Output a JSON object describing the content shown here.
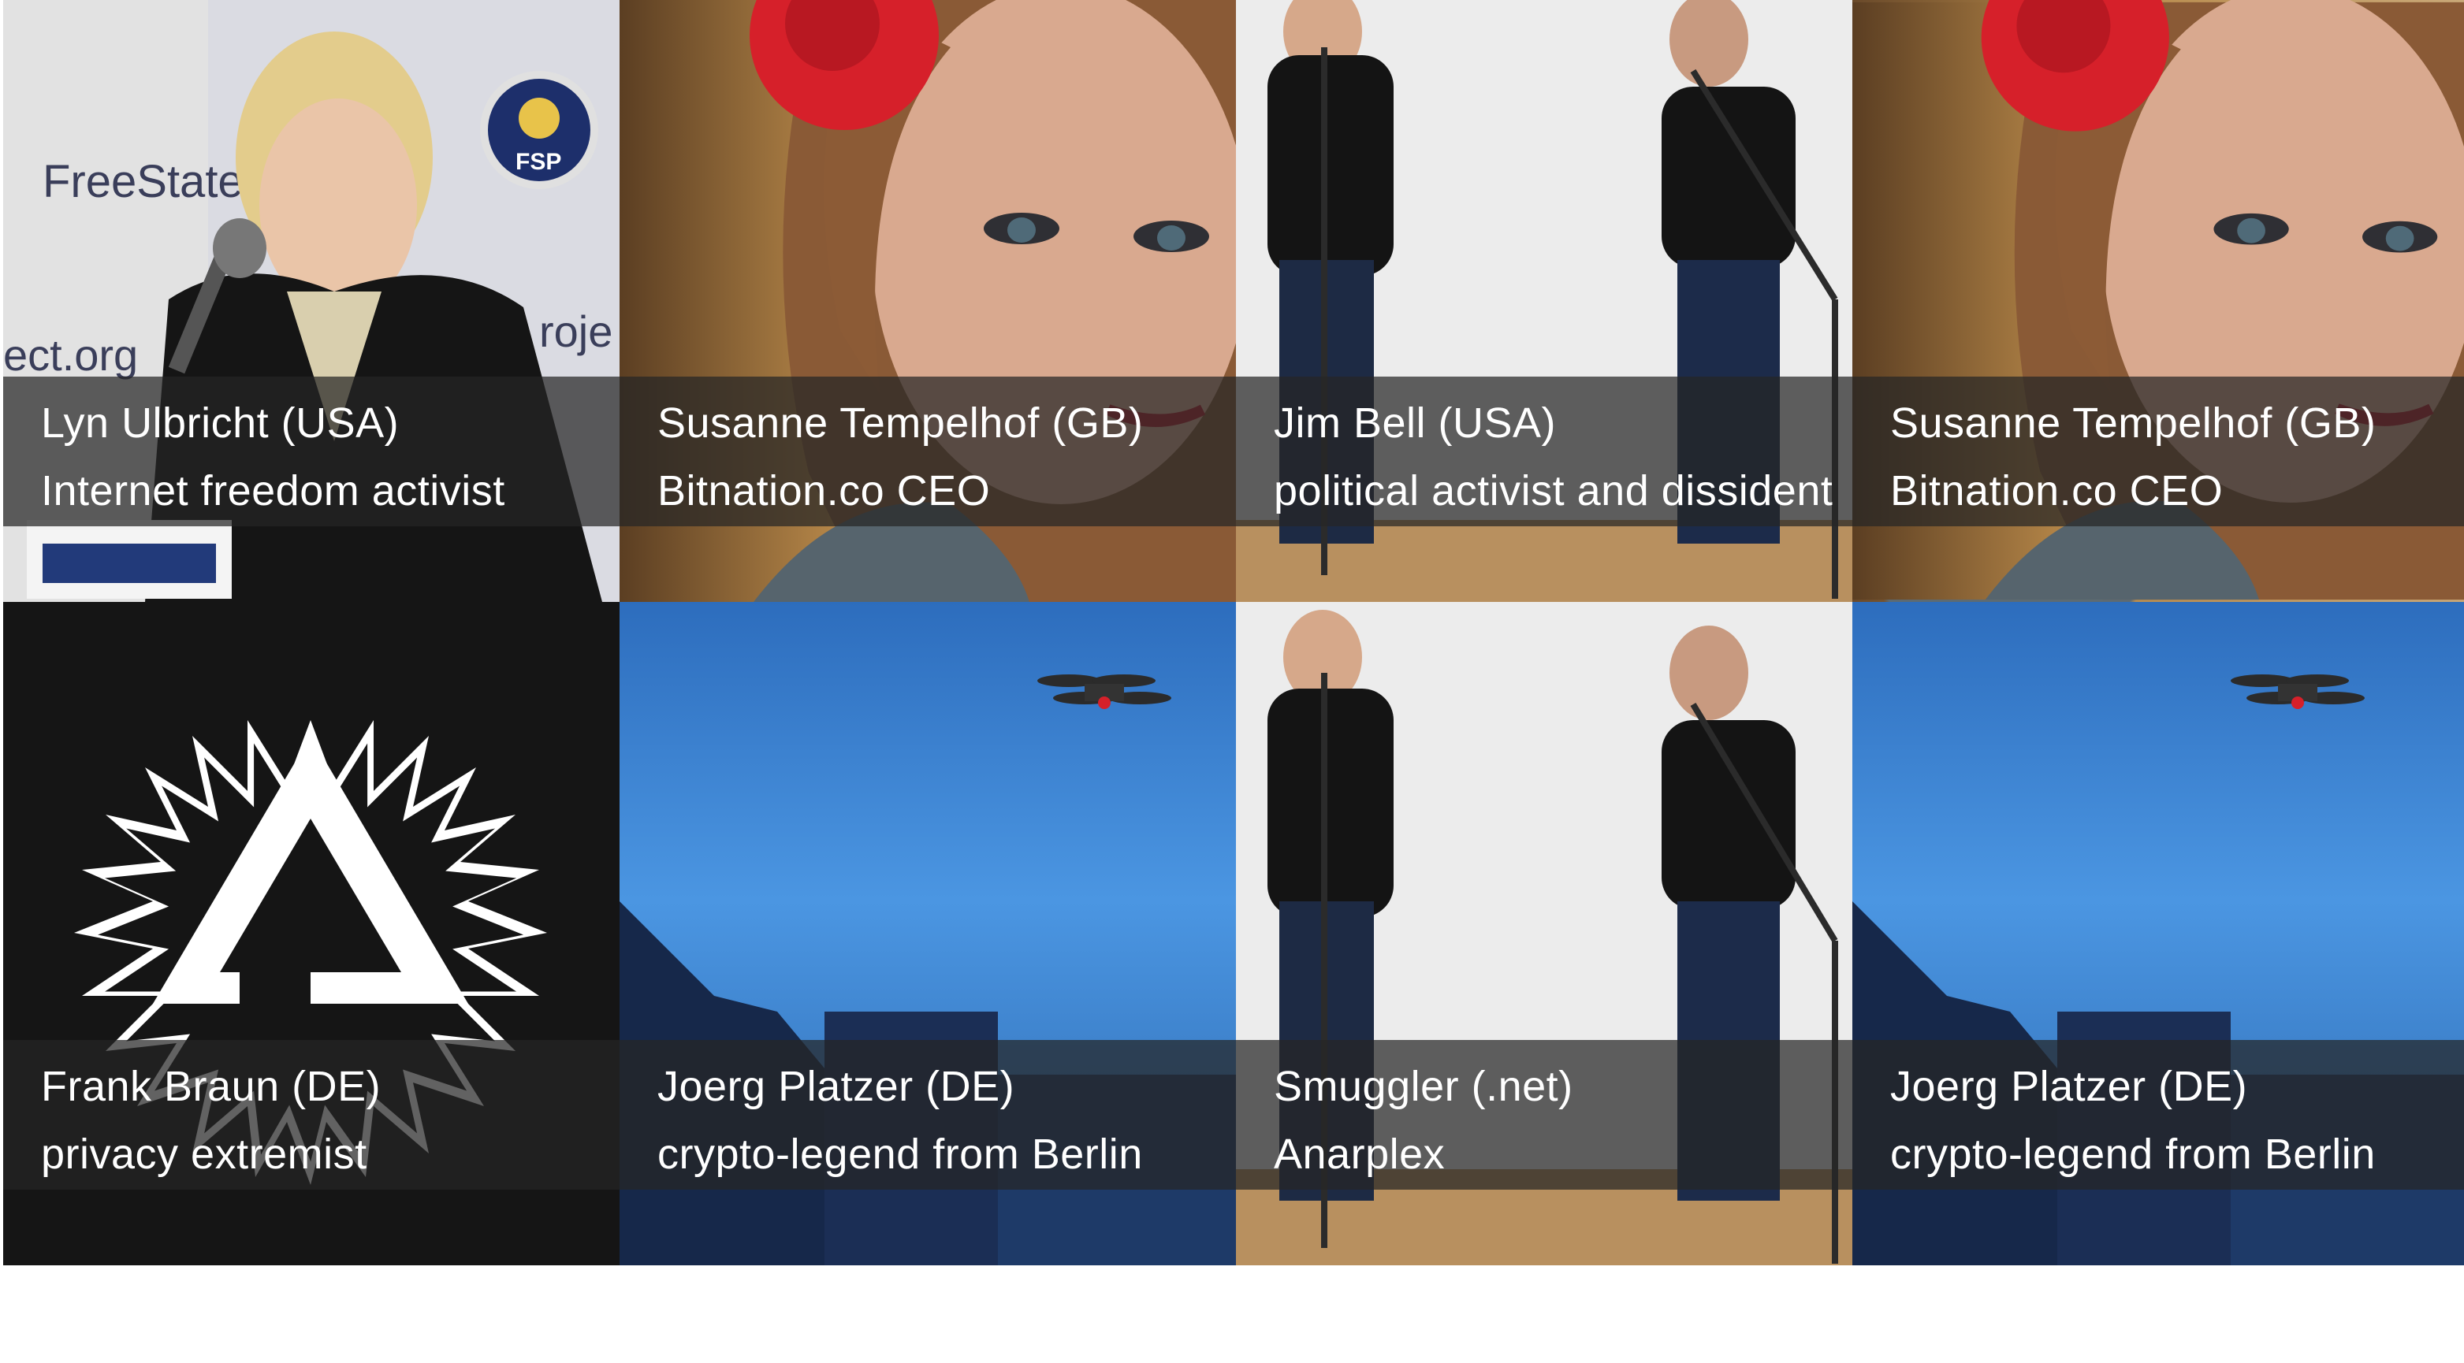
{
  "speakers": [
    {
      "name": "Lyn Ulbricht (USA)",
      "role": "Internet freedom activist",
      "art": "photo-lyn"
    },
    {
      "name": "Susanne Tempelhof (GB)",
      "role": "Bitnation.co CEO",
      "art": "photo-susanne"
    },
    {
      "name": "Jim Bell (USA)",
      "role": "political activist and dissident",
      "art": "photo-duo"
    },
    {
      "name": "Susanne Tempelhof (GB)",
      "role": "Bitnation.co CEO",
      "art": "photo-susanne"
    },
    {
      "name": "Frank Braun (DE)",
      "role": "privacy extremist",
      "art": "logo-triangle"
    },
    {
      "name": "Joerg Platzer (DE)",
      "role": "crypto-legend from Berlin",
      "art": "photo-drone"
    },
    {
      "name": "Smuggler (.net)",
      "role": "Anarplex",
      "art": "photo-duo"
    },
    {
      "name": "Joerg Platzer (DE)",
      "role": "crypto-legend from Berlin",
      "art": "photo-drone"
    }
  ],
  "photo_text": {
    "lyn_banner": "FreeState",
    "lyn_url": "ect.org",
    "lyn_proj": "roje",
    "lyn_seal": "FSP"
  },
  "colors": {
    "caption_bg": "#262626",
    "caption_text": "#ffffff",
    "flower": "#d6202a",
    "sky": "#3f86d6"
  }
}
